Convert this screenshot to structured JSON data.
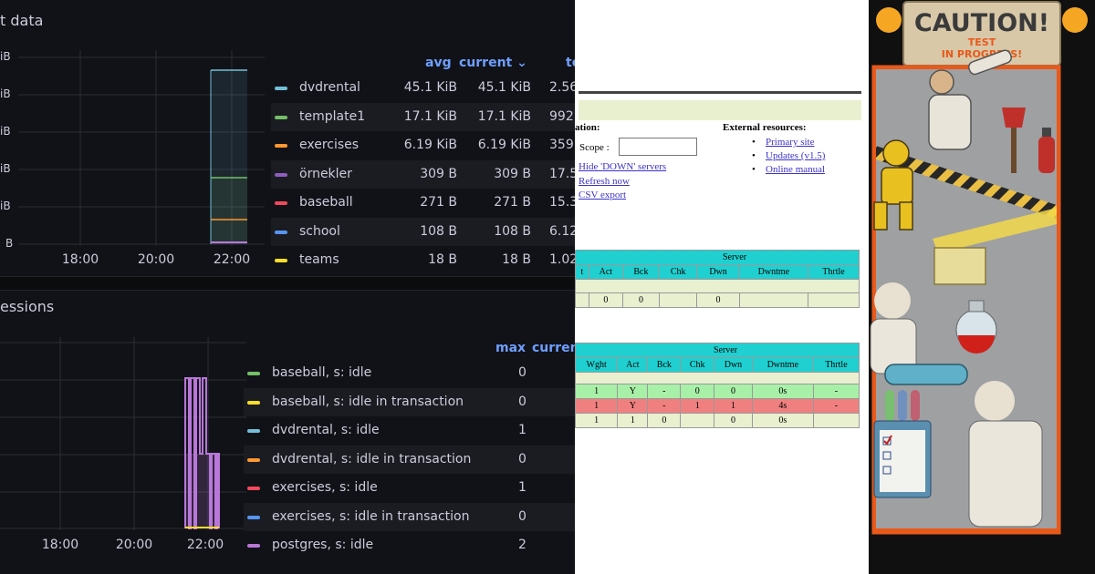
{
  "grafana": {
    "panel1": {
      "title": "t data",
      "y_ticks": [
        "iB",
        "iB",
        "iB",
        "iB",
        "iB",
        "B"
      ],
      "x_ticks": [
        "18:00",
        "20:00",
        "22:00"
      ],
      "legend_headers": {
        "avg": "avg",
        "current": "current",
        "total_partial": "to"
      },
      "current_sort_icon": "chevron-down-icon",
      "rows": [
        {
          "name": "dvdrental",
          "avg": "45.1 KiB",
          "current": "45.1 KiB",
          "total": "2.56",
          "color": "#73bfd8"
        },
        {
          "name": "template1",
          "avg": "17.1 KiB",
          "current": "17.1 KiB",
          "total": "992",
          "color": "#73bf69"
        },
        {
          "name": "exercises",
          "avg": "6.19 KiB",
          "current": "6.19 KiB",
          "total": "359",
          "color": "#ff9830"
        },
        {
          "name": "örnekler",
          "avg": "309 B",
          "current": "309 B",
          "total": "17.5",
          "color": "#8f5ec0"
        },
        {
          "name": "baseball",
          "avg": "271 B",
          "current": "271 B",
          "total": "15.3",
          "color": "#f2495c"
        },
        {
          "name": "school",
          "avg": "108 B",
          "current": "108 B",
          "total": "6.12",
          "color": "#5794f2"
        },
        {
          "name": "teams",
          "avg": "18 B",
          "current": "18 B",
          "total": "1.02",
          "color": "#fade2a"
        }
      ]
    },
    "panel2": {
      "title": "essions",
      "x_ticks": [
        "18:00",
        "20:00",
        "22:00"
      ],
      "legend_headers": {
        "max": "max",
        "current_partial": "curren"
      },
      "rows": [
        {
          "name": "baseball, s: idle",
          "max": "0",
          "color": "#73bf69"
        },
        {
          "name": "baseball, s: idle in transaction",
          "max": "0",
          "color": "#fade2a"
        },
        {
          "name": "dvdrental, s: idle",
          "max": "1",
          "color": "#73bfd8"
        },
        {
          "name": "dvdrental, s: idle in transaction",
          "max": "0",
          "color": "#ff9830"
        },
        {
          "name": "exercises, s: idle",
          "max": "1",
          "color": "#f2495c"
        },
        {
          "name": "exercises, s: idle in transaction",
          "max": "0",
          "color": "#5794f2"
        },
        {
          "name": "postgres, s: idle",
          "max": "2",
          "color": "#b877d9"
        }
      ]
    }
  },
  "haproxy": {
    "section_label": "ation:",
    "scope_label": "Scope :",
    "links_left": [
      "Hide 'DOWN' servers",
      "Refresh now",
      "CSV export"
    ],
    "external_title": "External resources:",
    "links_right": [
      "Primary site",
      "Updates (v1.5)",
      "Online manual"
    ],
    "table1": {
      "group": "Server",
      "headers": [
        "t",
        "Act",
        "Bck",
        "Chk",
        "Dwn",
        "Dwntme",
        "Thrtle"
      ],
      "row": [
        "",
        "0",
        "0",
        "",
        "0",
        "",
        ""
      ]
    },
    "table2": {
      "group": "Server",
      "headers": [
        "Wght",
        "Act",
        "Bck",
        "Chk",
        "Dwn",
        "Dwntme",
        "Thrtle"
      ],
      "rows": [
        {
          "cells": [
            "1",
            "Y",
            "-",
            "0",
            "0",
            "0s",
            "-"
          ],
          "status": "up"
        },
        {
          "cells": [
            "1",
            "Y",
            "-",
            "1",
            "1",
            "4s",
            "-"
          ],
          "status": "down"
        },
        {
          "cells": [
            "1",
            "1",
            "0",
            "",
            "0",
            "0s",
            ""
          ],
          "status": "total"
        }
      ]
    }
  },
  "caution": {
    "sign_text": "CAUTION!",
    "sub_text_1": "TEST",
    "sub_text_2": "IN PROGRESS!",
    "accent": "#e8591a",
    "sign_color": "#d8c8a8"
  }
}
